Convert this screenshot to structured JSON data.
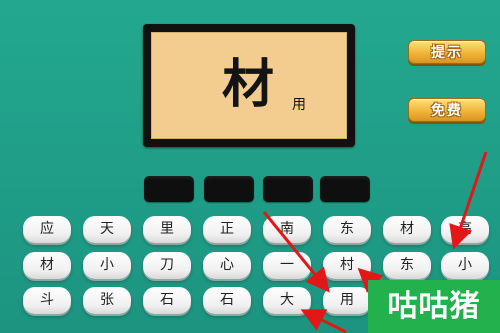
{
  "puzzle": {
    "big_char": "材",
    "small_char": "用"
  },
  "buttons": {
    "hint": "提示",
    "free": "免费"
  },
  "colors": {
    "background": "#1f9d86",
    "picture": "#f3cd8f",
    "button": "#f0b53a",
    "arrow": "#e01818",
    "watermark": "#22b14c"
  },
  "answer_slots": 4,
  "keyboard": {
    "rows": [
      [
        "应",
        "天",
        "里",
        "正",
        "南",
        "东",
        "材",
        "高"
      ],
      [
        "材",
        "小",
        "刀",
        "心",
        "一",
        "村",
        "东",
        "小"
      ],
      [
        "斗",
        "张",
        "石",
        "石",
        "大",
        "用",
        "",
        ""
      ]
    ]
  },
  "watermark": "咕咕猪"
}
